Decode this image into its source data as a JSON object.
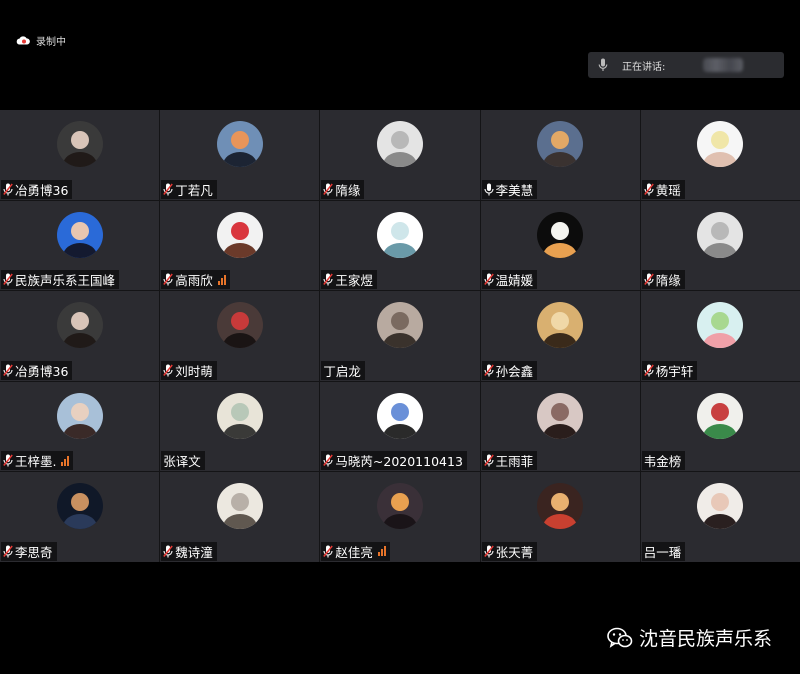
{
  "recording": {
    "label": "录制中",
    "icon": "cloud-record-icon"
  },
  "speaking": {
    "label": "正在讲话:",
    "icon": "microphone-icon"
  },
  "participants": [
    {
      "name": "冶勇博36",
      "mic": "muted",
      "signal": false,
      "avatar": [
        "#3a3a3a",
        "#d8c4b8",
        "#201a18"
      ]
    },
    {
      "name": "丁若凡",
      "mic": "muted",
      "signal": false,
      "avatar": [
        "#6f8fb6",
        "#e8955a",
        "#1c2433"
      ]
    },
    {
      "name": "隋缘",
      "mic": "muted",
      "signal": false,
      "avatar": [
        "#e4e4e4",
        "#b8b8b8",
        "#8a8a8a"
      ]
    },
    {
      "name": "李美慧",
      "mic": "on",
      "signal": false,
      "avatar": [
        "#5b6f8f",
        "#e2a866",
        "#3a3230"
      ]
    },
    {
      "name": "黄瑶",
      "mic": "muted",
      "signal": false,
      "avatar": [
        "#f6f6f6",
        "#f0e6a8",
        "#e0c0b0"
      ]
    },
    {
      "name": "民族声乐系王国峰",
      "mic": "muted",
      "signal": false,
      "avatar": [
        "#2a6ad8",
        "#e8c6b0",
        "#141a30"
      ]
    },
    {
      "name": "高雨欣",
      "mic": "muted",
      "signal": true,
      "avatar": [
        "#f2f2f2",
        "#d9363e",
        "#6b3a2a"
      ]
    },
    {
      "name": "王家煜",
      "mic": "muted",
      "signal": false,
      "avatar": [
        "#ffffff",
        "#cfe6ea",
        "#6a9aa8"
      ]
    },
    {
      "name": "温婧媛",
      "mic": "muted",
      "signal": false,
      "avatar": [
        "#0c0c0c",
        "#f4f4f0",
        "#e8a050"
      ]
    },
    {
      "name": "隋缘",
      "mic": "muted",
      "signal": false,
      "avatar": [
        "#e4e4e4",
        "#b8b8b8",
        "#8a8a8a"
      ]
    },
    {
      "name": "冶勇博36",
      "mic": "muted",
      "signal": false,
      "avatar": [
        "#3a3a3a",
        "#d8c4b8",
        "#201a18"
      ]
    },
    {
      "name": "刘时萌",
      "mic": "muted",
      "signal": false,
      "avatar": [
        "#4a3a38",
        "#c83a3a",
        "#1a1414"
      ]
    },
    {
      "name": "丁启龙",
      "mic": "none",
      "signal": false,
      "avatar": [
        "#b8aaa0",
        "#7a6a60",
        "#3a322c"
      ]
    },
    {
      "name": "孙会鑫",
      "mic": "muted",
      "signal": false,
      "avatar": [
        "#d9b070",
        "#f0d8a8",
        "#3a2a1a"
      ]
    },
    {
      "name": "杨宇轩",
      "mic": "muted",
      "signal": false,
      "avatar": [
        "#d8f0f0",
        "#a8d890",
        "#f0a0a8"
      ]
    },
    {
      "name": "王梓墨.",
      "mic": "muted",
      "signal": true,
      "avatar": [
        "#a8c0d8",
        "#e8d0c0",
        "#3a2a28"
      ]
    },
    {
      "name": "张译文",
      "mic": "none",
      "signal": false,
      "avatar": [
        "#e8e4d8",
        "#b8c8b8",
        "#3a3a38"
      ]
    },
    {
      "name": "马晓芮~2020110413",
      "mic": "muted",
      "signal": false,
      "avatar": [
        "#ffffff",
        "#6a90d8",
        "#2a2a2a"
      ]
    },
    {
      "name": "王雨菲",
      "mic": "muted",
      "signal": false,
      "avatar": [
        "#d8c8c4",
        "#8a6a64",
        "#2a1e1c"
      ]
    },
    {
      "name": "韦金榜",
      "mic": "none",
      "signal": false,
      "avatar": [
        "#f0f0ec",
        "#c84040",
        "#3a8a4a"
      ]
    },
    {
      "name": "李思奇",
      "mic": "muted",
      "signal": false,
      "avatar": [
        "#101828",
        "#c89060",
        "#2a3a5a"
      ]
    },
    {
      "name": "魏诗潼",
      "mic": "muted",
      "signal": false,
      "avatar": [
        "#ece8e0",
        "#b8b0a8",
        "#605850"
      ]
    },
    {
      "name": "赵佳亮",
      "mic": "muted",
      "signal": true,
      "avatar": [
        "#3a3038",
        "#e8a050",
        "#1a1418"
      ]
    },
    {
      "name": "张天菁",
      "mic": "muted",
      "signal": false,
      "avatar": [
        "#3a2420",
        "#e8b070",
        "#c84030"
      ]
    },
    {
      "name": "吕一璠",
      "mic": "none",
      "signal": false,
      "avatar": [
        "#f0ece8",
        "#e8c8b8",
        "#2a2020"
      ]
    }
  ],
  "watermark": {
    "label": "沈音民族声乐系",
    "icon": "wechat-icon"
  }
}
